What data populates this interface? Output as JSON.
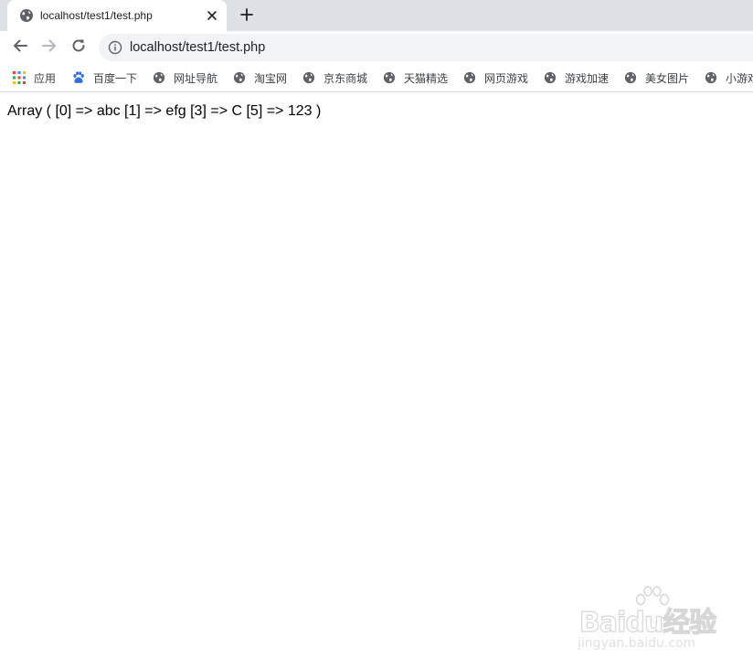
{
  "tab": {
    "title": "localhost/test1/test.php",
    "favicon": "globe-icon",
    "close_icon": "close-icon",
    "new_tab_icon": "plus-icon"
  },
  "toolbar": {
    "back_icon": "back-arrow-icon",
    "forward_icon": "forward-arrow-icon",
    "reload_icon": "reload-icon",
    "info_icon": "info-icon",
    "url": "localhost/test1/test.php"
  },
  "bookmarks": [
    {
      "label": "应用",
      "icon": "apps-grid-icon"
    },
    {
      "label": "百度一下",
      "icon": "baidu-paw-icon"
    },
    {
      "label": "网址导航",
      "icon": "globe-icon"
    },
    {
      "label": "淘宝网",
      "icon": "globe-icon"
    },
    {
      "label": "京东商城",
      "icon": "globe-icon"
    },
    {
      "label": "天猫精选",
      "icon": "globe-icon"
    },
    {
      "label": "网页游戏",
      "icon": "globe-icon"
    },
    {
      "label": "游戏加速",
      "icon": "globe-icon"
    },
    {
      "label": "美女图片",
      "icon": "globe-icon"
    },
    {
      "label": "小游戏",
      "icon": "globe-icon"
    }
  ],
  "page": {
    "output": "Array ( [0] => abc [1] => efg [3] => C [5] => 123 )"
  },
  "watermark": {
    "brand": "Baidu经验",
    "sub": "jingyan.baidu.com"
  },
  "colors": {
    "tab_strip": "#dee1e6",
    "omnibox": "#f1f3f4",
    "icon_gray": "#5f6368"
  }
}
